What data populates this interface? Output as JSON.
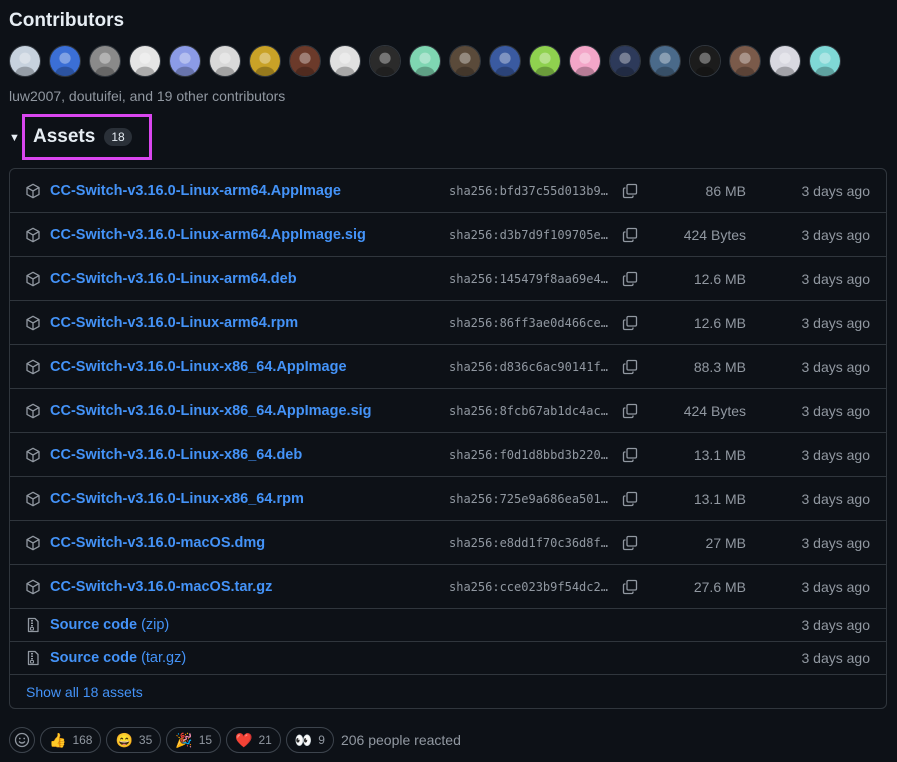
{
  "contributors": {
    "title": "Contributors",
    "summary": "luw2007, doutuifei, and 19 other contributors",
    "avatar_colors": [
      "#c7d2de",
      "#3b6fd6",
      "#8a8a8a",
      "#e5e5e5",
      "#8b9be6",
      "#d9d9d9",
      "#c9a227",
      "#6b3a2a",
      "#e0e0e0",
      "#2b2b2b",
      "#7fd6b2",
      "#5a4a3a",
      "#3a5aa0",
      "#8fd14f",
      "#f3a6c8",
      "#2d3a5a",
      "#4a6a8a",
      "#1c1c1c",
      "#7a5a4a",
      "#d8d8e0",
      "#7fd8d6"
    ]
  },
  "assets": {
    "title": "Assets",
    "count": "18",
    "files": [
      {
        "name": "CC-Switch-v3.16.0-Linux-arm64.AppImage",
        "sha": "sha256:bfd37c55d013b9…",
        "size": "86 MB",
        "date": "3 days ago"
      },
      {
        "name": "CC-Switch-v3.16.0-Linux-arm64.AppImage.sig",
        "sha": "sha256:d3b7d9f109705e…",
        "size": "424 Bytes",
        "date": "3 days ago"
      },
      {
        "name": "CC-Switch-v3.16.0-Linux-arm64.deb",
        "sha": "sha256:145479f8aa69e4…",
        "size": "12.6 MB",
        "date": "3 days ago"
      },
      {
        "name": "CC-Switch-v3.16.0-Linux-arm64.rpm",
        "sha": "sha256:86ff3ae0d466ce…",
        "size": "12.6 MB",
        "date": "3 days ago"
      },
      {
        "name": "CC-Switch-v3.16.0-Linux-x86_64.AppImage",
        "sha": "sha256:d836c6ac90141f…",
        "size": "88.3 MB",
        "date": "3 days ago"
      },
      {
        "name": "CC-Switch-v3.16.0-Linux-x86_64.AppImage.sig",
        "sha": "sha256:8fcb67ab1dc4ac…",
        "size": "424 Bytes",
        "date": "3 days ago"
      },
      {
        "name": "CC-Switch-v3.16.0-Linux-x86_64.deb",
        "sha": "sha256:f0d1d8bbd3b220…",
        "size": "13.1 MB",
        "date": "3 days ago"
      },
      {
        "name": "CC-Switch-v3.16.0-Linux-x86_64.rpm",
        "sha": "sha256:725e9a686ea501…",
        "size": "13.1 MB",
        "date": "3 days ago"
      },
      {
        "name": "CC-Switch-v3.16.0-macOS.dmg",
        "sha": "sha256:e8dd1f70c36d8f…",
        "size": "27 MB",
        "date": "3 days ago"
      },
      {
        "name": "CC-Switch-v3.16.0-macOS.tar.gz",
        "sha": "sha256:cce023b9f54dc2…",
        "size": "27.6 MB",
        "date": "3 days ago"
      }
    ],
    "source": [
      {
        "label": "Source code",
        "suffix": "(zip)",
        "date": "3 days ago"
      },
      {
        "label": "Source code",
        "suffix": "(tar.gz)",
        "date": "3 days ago"
      }
    ],
    "show_all": "Show all 18 assets"
  },
  "reactions": {
    "items": [
      {
        "emoji": "👍",
        "count": "168"
      },
      {
        "emoji": "😄",
        "count": "35"
      },
      {
        "emoji": "🎉",
        "count": "15"
      },
      {
        "emoji": "❤️",
        "count": "21"
      },
      {
        "emoji": "👀",
        "count": "9"
      }
    ],
    "total": "206 people reacted"
  }
}
